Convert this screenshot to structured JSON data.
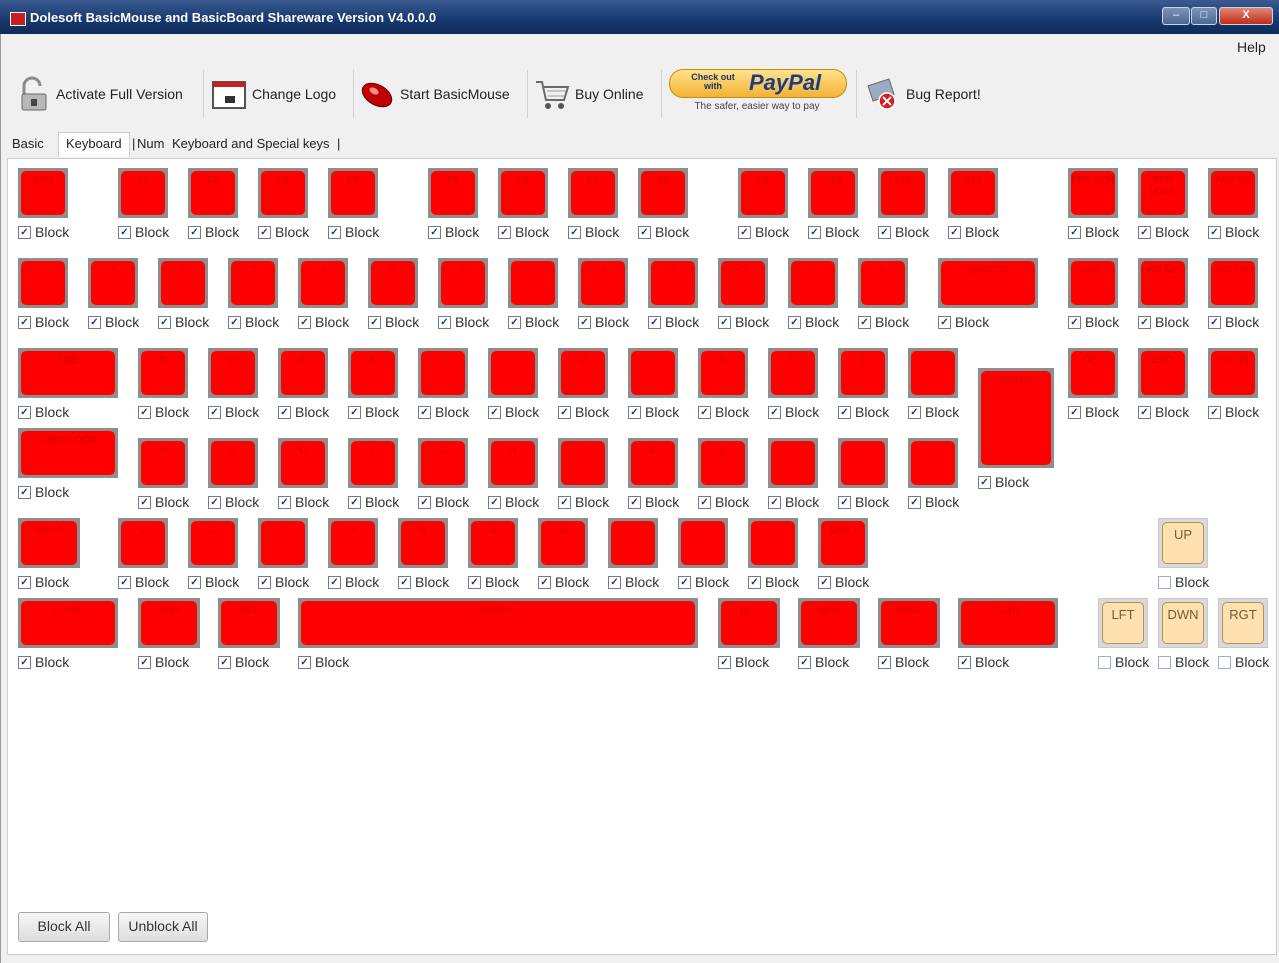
{
  "window": {
    "title": "Dolesoft BasicMouse and BasicBoard Shareware Version V4.0.0.0",
    "close_label": "X"
  },
  "menu": {
    "help": "Help"
  },
  "toolbar": {
    "activate": "Activate Full Version",
    "change_logo": "Change Logo",
    "start_basicmouse": "Start BasicMouse",
    "buy_online": "Buy Online",
    "paypal_checkout": "Check out with",
    "paypal_brand": "PayPal",
    "paypal_tagline": "The safer, easier way to pay",
    "bug_report": "Bug Report!"
  },
  "tabs": {
    "basic": "Basic",
    "keyboard": "Keyboard",
    "num": "Num",
    "special": "Keyboard and Special keys"
  },
  "block_label": "Block",
  "colors": {
    "key_red": "#ff0000",
    "key_frame": "#8e8e8e",
    "nav_key": "#ffe0b0"
  },
  "rows": [
    [
      {
        "id": "esc",
        "label": "ESC",
        "checked": true
      },
      {
        "id": "f1",
        "label": "F1",
        "checked": true
      },
      {
        "id": "f2",
        "label": "F2",
        "checked": true
      },
      {
        "id": "f3",
        "label": "F3",
        "checked": true
      },
      {
        "id": "f4",
        "label": "F4",
        "checked": true
      },
      {
        "id": "f5",
        "label": "F5",
        "checked": true
      },
      {
        "id": "f6",
        "label": "F6",
        "checked": true
      },
      {
        "id": "f7",
        "label": "F7",
        "checked": true
      },
      {
        "id": "f8",
        "label": "F8",
        "checked": true
      },
      {
        "id": "f9",
        "label": "F9",
        "checked": true
      },
      {
        "id": "f10",
        "label": "F10",
        "checked": true
      },
      {
        "id": "f11",
        "label": "F11",
        "checked": true
      },
      {
        "id": "f12",
        "label": "F12",
        "checked": true
      },
      {
        "id": "prtscr",
        "label": "PRT SCR",
        "checked": true
      },
      {
        "id": "scrlock",
        "label": "SCR LOCK",
        "checked": true
      },
      {
        "id": "pause",
        "label": "PAU SE",
        "checked": true
      }
    ],
    [
      {
        "id": "backtick",
        "label": "`",
        "checked": true
      },
      {
        "id": "k1",
        "label": "1",
        "checked": true
      },
      {
        "id": "k2",
        "label": "2",
        "checked": true
      },
      {
        "id": "k3",
        "label": "3",
        "checked": true
      },
      {
        "id": "k4",
        "label": "4",
        "checked": true
      },
      {
        "id": "k5",
        "label": "5",
        "checked": true
      },
      {
        "id": "k6",
        "label": "6",
        "checked": true
      },
      {
        "id": "k7",
        "label": "7",
        "checked": true
      },
      {
        "id": "k8",
        "label": "8",
        "checked": true
      },
      {
        "id": "k9",
        "label": "9",
        "checked": true
      },
      {
        "id": "k0",
        "label": "0",
        "checked": true
      },
      {
        "id": "minus",
        "label": "-",
        "checked": true
      },
      {
        "id": "equals",
        "label": "=",
        "checked": true
      },
      {
        "id": "backsp",
        "label": "BACKSP",
        "checked": true
      },
      {
        "id": "ins",
        "label": "INS",
        "checked": true
      },
      {
        "id": "home",
        "label": "HO ME",
        "checked": true
      },
      {
        "id": "pgup",
        "label": "PG UP",
        "checked": true
      }
    ],
    [
      {
        "id": "tab",
        "label": "TAB",
        "checked": true
      },
      {
        "id": "q",
        "label": "Q",
        "checked": true
      },
      {
        "id": "w",
        "label": "W",
        "checked": true
      },
      {
        "id": "e",
        "label": "E",
        "checked": true
      },
      {
        "id": "r",
        "label": "R",
        "checked": true
      },
      {
        "id": "t",
        "label": "T",
        "checked": true
      },
      {
        "id": "y",
        "label": "Y",
        "checked": true
      },
      {
        "id": "u",
        "label": "U",
        "checked": true
      },
      {
        "id": "i",
        "label": "I",
        "checked": true
      },
      {
        "id": "o",
        "label": "O",
        "checked": true
      },
      {
        "id": "p",
        "label": "P",
        "checked": true
      },
      {
        "id": "lbracket",
        "label": "[",
        "checked": true
      },
      {
        "id": "rbracket",
        "label": "]",
        "checked": true
      },
      {
        "id": "del",
        "label": "DEL",
        "checked": true
      },
      {
        "id": "end",
        "label": "END",
        "checked": true
      },
      {
        "id": "pgdn",
        "label": "PG DN",
        "checked": true
      }
    ],
    [
      {
        "id": "capslock",
        "label": "CAPS LOCK",
        "checked": true
      },
      {
        "id": "a",
        "label": "A",
        "checked": true
      },
      {
        "id": "s",
        "label": "S",
        "checked": true
      },
      {
        "id": "d",
        "label": "D",
        "checked": true
      },
      {
        "id": "f",
        "label": "F",
        "checked": true
      },
      {
        "id": "g",
        "label": "G",
        "checked": true
      },
      {
        "id": "h",
        "label": "H",
        "checked": true
      },
      {
        "id": "j",
        "label": "J",
        "checked": true
      },
      {
        "id": "k",
        "label": "K",
        "checked": true
      },
      {
        "id": "l",
        "label": "L",
        "checked": true
      },
      {
        "id": "semicolon",
        "label": ";",
        "checked": true
      },
      {
        "id": "quote",
        "label": "'",
        "checked": true
      },
      {
        "id": "backslash",
        "label": "\\",
        "checked": true
      },
      {
        "id": "enter",
        "label": "ENTER",
        "checked": true
      }
    ],
    [
      {
        "id": "lshift",
        "label": "SHIFT",
        "checked": true
      },
      {
        "id": "z",
        "label": "Z",
        "checked": true
      },
      {
        "id": "x",
        "label": "X",
        "checked": true
      },
      {
        "id": "c",
        "label": "C",
        "checked": true
      },
      {
        "id": "v",
        "label": "V",
        "checked": true
      },
      {
        "id": "b",
        "label": "B",
        "checked": true
      },
      {
        "id": "n",
        "label": "N",
        "checked": true
      },
      {
        "id": "m",
        "label": "M",
        "checked": true
      },
      {
        "id": "comma",
        "label": ",",
        "checked": true
      },
      {
        "id": "period",
        "label": ".",
        "checked": true
      },
      {
        "id": "slash",
        "label": "/",
        "checked": true
      },
      {
        "id": "rshift",
        "label": "SHIFT",
        "checked": true
      },
      {
        "id": "up",
        "label": "UP",
        "checked": false
      }
    ],
    [
      {
        "id": "lctrl",
        "label": "CTRL",
        "checked": true
      },
      {
        "id": "lwin",
        "label": "WIN",
        "checked": true
      },
      {
        "id": "lalt",
        "label": "ALT",
        "checked": true
      },
      {
        "id": "space",
        "label": "SPACE",
        "checked": true
      },
      {
        "id": "ralt",
        "label": "ALT",
        "checked": true
      },
      {
        "id": "rwin",
        "label": "WIN",
        "checked": true
      },
      {
        "id": "menu",
        "label": "MNU",
        "checked": true
      },
      {
        "id": "rctrl",
        "label": "CTRL",
        "checked": true
      },
      {
        "id": "left",
        "label": "LFT",
        "checked": false
      },
      {
        "id": "down",
        "label": "DWN",
        "checked": false
      },
      {
        "id": "right",
        "label": "RGT",
        "checked": false
      }
    ]
  ],
  "bottom": {
    "block_all": "Block All",
    "unblock_all": "Unblock All"
  }
}
